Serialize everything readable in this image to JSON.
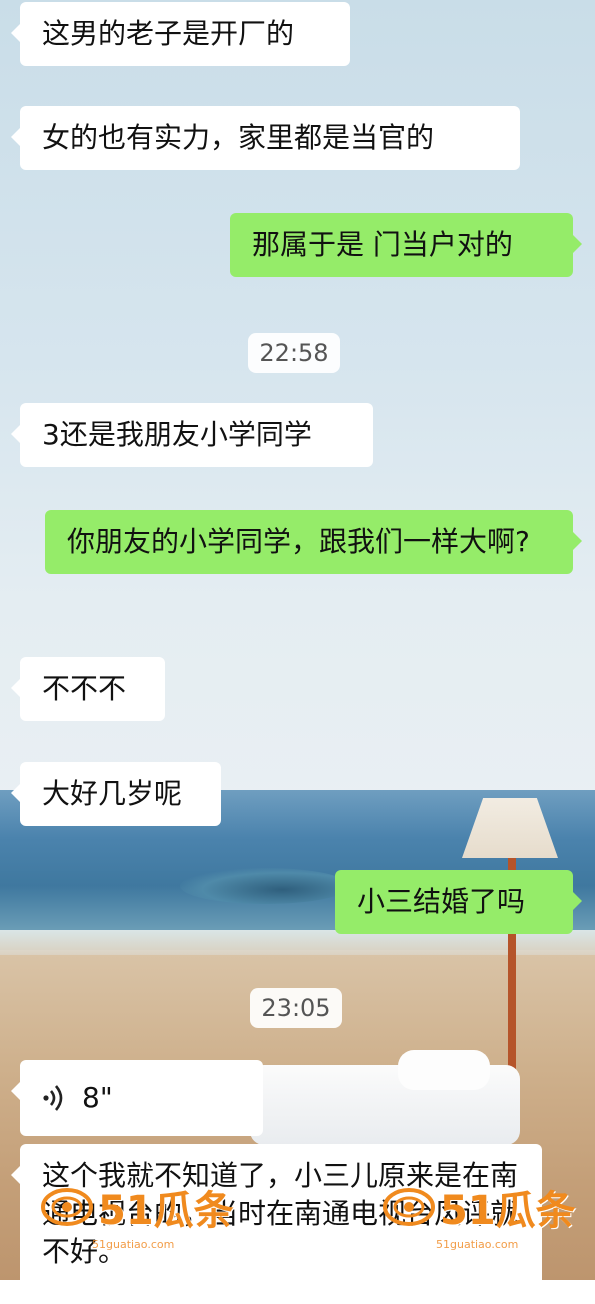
{
  "colors": {
    "incoming_bubble": "#ffffff",
    "outgoing_bubble": "#95ec69",
    "watermark": "#f08a1e"
  },
  "messages": [
    {
      "side": "in",
      "text": "这男的老子是开厂的"
    },
    {
      "side": "in",
      "text": "女的也有实力，家里都是当官的"
    },
    {
      "side": "out",
      "text": "那属于是 门当户对的"
    },
    {
      "timestamp": "22:58"
    },
    {
      "side": "in",
      "text": "3还是我朋友小学同学"
    },
    {
      "side": "out",
      "text": "你朋友的小学同学，跟我们一样大啊?"
    },
    {
      "side": "in",
      "text": "不不不"
    },
    {
      "side": "in",
      "text": "大好几岁呢"
    },
    {
      "side": "out",
      "text": "小三结婚了吗"
    },
    {
      "timestamp": "23:05"
    },
    {
      "side": "in",
      "type": "voice",
      "icon": "voice-wave-icon",
      "duration": "8\""
    },
    {
      "side": "in",
      "text": "这个我就不知道了，小三儿原来是在南通电视台的，当时在南通电视台风评就不好。"
    }
  ],
  "watermark": {
    "text": "51瓜条",
    "subtext": "51guatiao.com"
  }
}
